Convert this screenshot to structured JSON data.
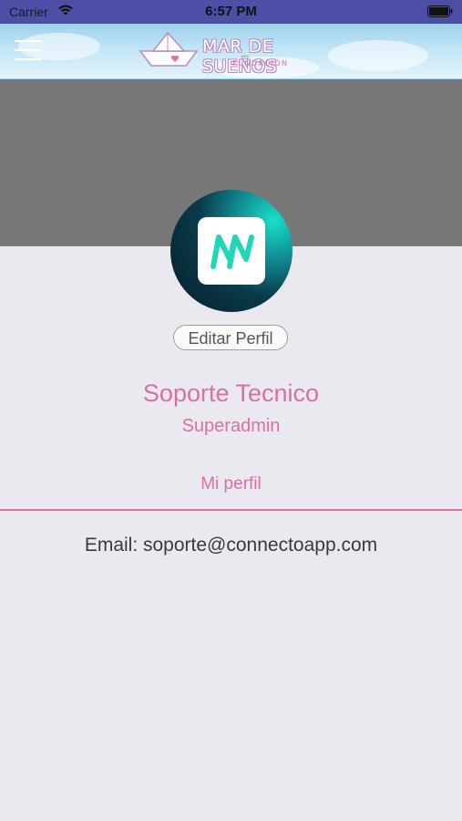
{
  "status_bar": {
    "carrier": "Carrier",
    "time": "6:57 PM",
    "wifi_icon": "wifi-icon",
    "battery_icon": "battery-icon"
  },
  "header": {
    "menu_icon": "hamburger-menu-icon",
    "logo_title": "MAR DE SUEÑOS",
    "logo_subtitle": "FUNDACIÓN",
    "logo_icon": "paper-boat-icon"
  },
  "profile": {
    "edit_label": "Editar Perfil",
    "name": "Soporte Tecnico",
    "role": "Superadmin",
    "tab_label": "Mi perfil",
    "email_text": "Email: soporte@connectoapp.com"
  },
  "colors": {
    "accent": "#d96fa8",
    "cover": "#777777",
    "status_bar": "#4d4fa6",
    "background": "#ebe9f0"
  }
}
